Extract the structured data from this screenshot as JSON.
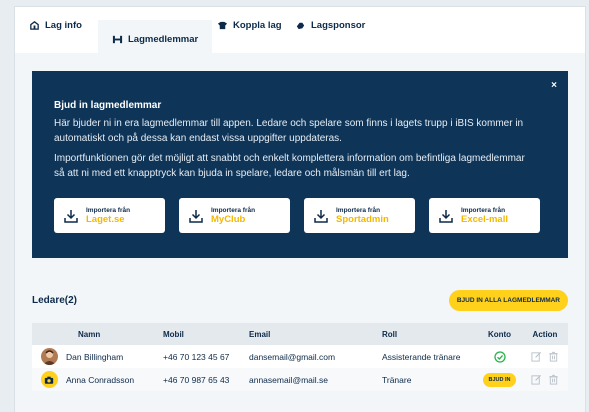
{
  "tabs": [
    {
      "label": "Lag info",
      "icon": "team-info-icon",
      "active": false
    },
    {
      "label": "Lagmedlemmar",
      "icon": "team-members-icon",
      "active": true
    },
    {
      "label": "Koppla lag",
      "icon": "link-team-icon",
      "active": false
    },
    {
      "label": "Lagsponsor",
      "icon": "sponsor-icon",
      "active": false
    }
  ],
  "banner": {
    "close": "×",
    "title": "Bjud in lagmedlemmar",
    "paragraph1": "Här bjuder ni in era lagmedlemmar till appen. Ledare och spelare som finns i lagets trupp i iBIS kommer in automatiskt och på dessa kan endast vissa uppgifter uppdateras.",
    "paragraph2": "Importfunktionen gör det möjligt att snabbt och enkelt komplettera information om befintliga lagmedlemmar så att ni med ett knapptryck kan bjuda in spelare, ledare och målsmän till ert lag.",
    "imports": [
      {
        "prefix": "Importera från",
        "source": "Laget.se"
      },
      {
        "prefix": "Importera från",
        "source": "MyClub"
      },
      {
        "prefix": "Importera från",
        "source": "Sportadmin"
      },
      {
        "prefix": "Importera från",
        "source": "Excel-mall"
      }
    ]
  },
  "leaders": {
    "title": "Ledare(2)",
    "invite_all": "BJUD IN ALLA LAGMEDLEMMAR",
    "columns": {
      "name": "Namn",
      "mobile": "Mobil",
      "email": "Email",
      "role": "Roll",
      "account": "Konto",
      "action": "Action"
    },
    "rows": [
      {
        "name": "Dan Billingham",
        "mobile": "+46 70 123 45 67",
        "email": "dansemail@gmail.com",
        "role": "Assisterande tränare",
        "account": "active",
        "avatar": "photo"
      },
      {
        "name": "Anna Conradsson",
        "mobile": "+46 70 987 65 43",
        "email": "annasemail@mail.se",
        "role": "Tränare",
        "account": "invite",
        "invite_label": "BJUD IN",
        "avatar": "camera"
      }
    ]
  },
  "colors": {
    "navy": "#0e3458",
    "yellow": "#ffd11a",
    "accent_text": "#f5b800",
    "green": "#2ab24a"
  }
}
